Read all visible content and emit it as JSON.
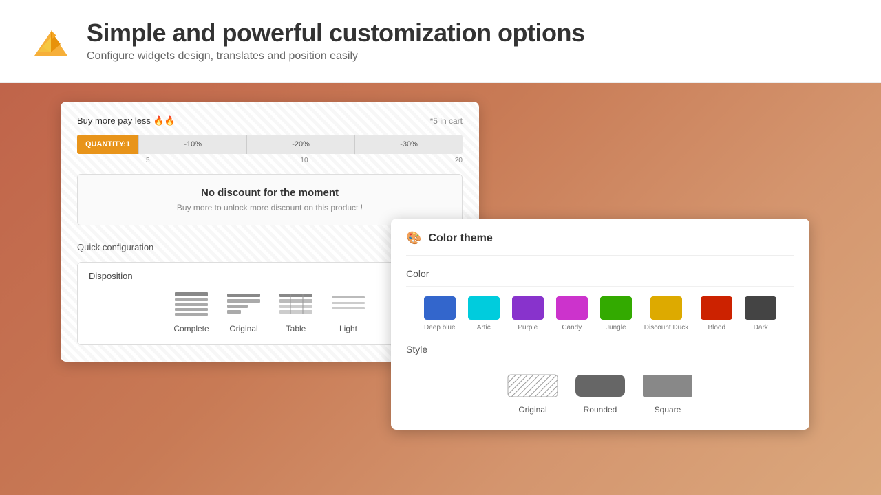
{
  "header": {
    "title": "Simple and powerful customization options",
    "subtitle": "Configure widgets design, translates and position easily",
    "logo_alt": "duck-logo"
  },
  "widget1": {
    "discount_title": "Buy more pay less 🔥🔥",
    "cart_info": "*5 in cart",
    "qty_label": "QUANTITY:1",
    "segments": [
      "-10%",
      "-20%",
      "-30%"
    ],
    "numbers": [
      "5",
      "10",
      "20"
    ],
    "no_discount_title": "No discount for the moment",
    "no_discount_sub": "Buy more to unlock more discount on this product !",
    "quick_config_label": "Quick configuration",
    "disposition_label": "Disposition",
    "disposition_options": [
      {
        "label": "Complete"
      },
      {
        "label": "Original"
      },
      {
        "label": "Table"
      },
      {
        "label": "Light"
      }
    ]
  },
  "widget2": {
    "title": "Color theme",
    "color_section_label": "Color",
    "colors": [
      {
        "name": "Deep blue",
        "hex": "#3366cc"
      },
      {
        "name": "Artic",
        "hex": "#00ccdd"
      },
      {
        "name": "Purple",
        "hex": "#8833cc"
      },
      {
        "name": "Candy",
        "hex": "#cc33cc"
      },
      {
        "name": "Jungle",
        "hex": "#33aa00"
      },
      {
        "name": "Discount Duck",
        "hex": "#ddaa00"
      },
      {
        "name": "Blood",
        "hex": "#cc2200"
      },
      {
        "name": "Dark",
        "hex": "#444444"
      }
    ],
    "style_section_label": "Style",
    "styles": [
      {
        "label": "Original"
      },
      {
        "label": "Rounded"
      },
      {
        "label": "Square"
      }
    ]
  }
}
